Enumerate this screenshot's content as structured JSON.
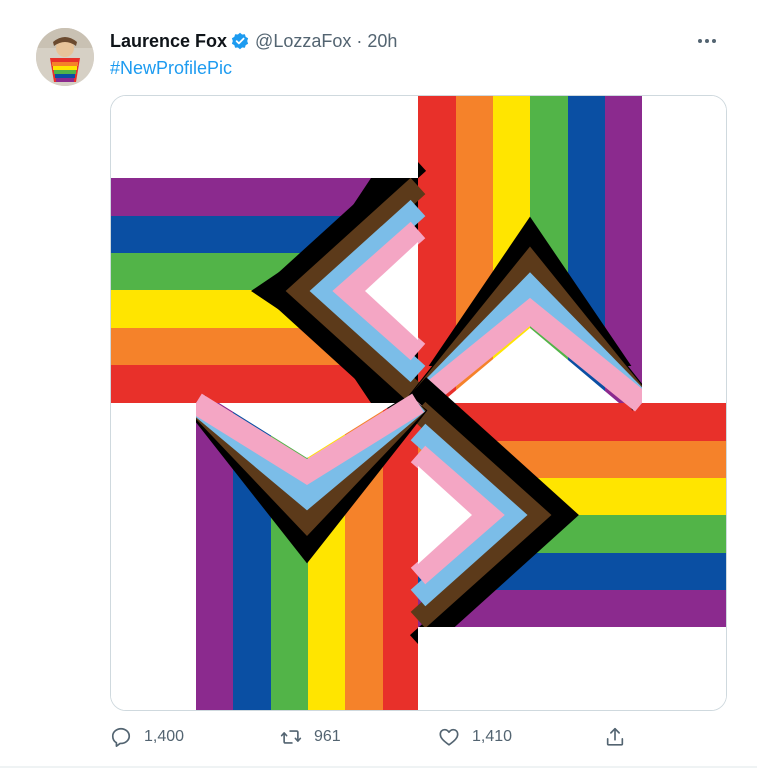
{
  "tweet": {
    "author_name": "Laurence Fox",
    "handle": "@LozzaFox",
    "separator": "·",
    "time": "20h",
    "hashtag": "#NewProfilePic",
    "verified": true
  },
  "actions": {
    "replies": "1,400",
    "retweets": "961",
    "likes": "1,410"
  },
  "icons": [
    "verified-badge-icon",
    "more-icon",
    "reply-icon",
    "retweet-icon",
    "like-icon",
    "share-icon"
  ],
  "colors": {
    "accent": "#1d9bf0",
    "muted": "#536471",
    "rainbow": [
      "#e8302a",
      "#f5822a",
      "#ffe500",
      "#52b448",
      "#0a4fa3",
      "#8b2a8e"
    ],
    "progress_stripes": [
      "#000000",
      "#5c3a1a",
      "#7bbde8",
      "#f4a6c4",
      "#ffffff"
    ]
  }
}
